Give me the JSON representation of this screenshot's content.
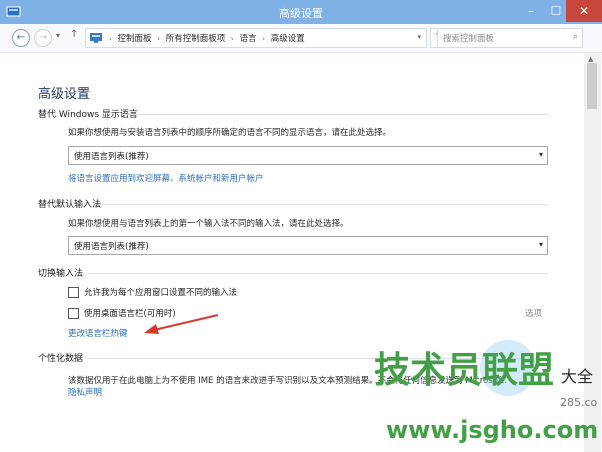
{
  "window": {
    "title": "高级设置"
  },
  "nav": {
    "up_label": "↑",
    "back_label": "←",
    "forward_label": "→",
    "recent_label": "▾"
  },
  "breadcrumb": {
    "items": [
      "控制面板",
      "所有控制面板项",
      "语言",
      "高级设置"
    ]
  },
  "search": {
    "placeholder": "搜索控制面板"
  },
  "page": {
    "title": "高级设置"
  },
  "display_language": {
    "heading": "替代 Windows 显示语言",
    "description": "如果你想使用与安装语言列表中的顺序所确定的语言不同的显示语言，请在此处选择。",
    "selected": "使用语言列表(推荐)",
    "link": "将语言设置应用到欢迎屏幕、系统帐户和新用户帐户"
  },
  "input_method": {
    "heading": "替代默认输入法",
    "description": "如果你想使用与语言列表上的第一个输入法不同的输入法，请在此处选择。",
    "selected": "使用语言列表(推荐)"
  },
  "switch_input": {
    "heading": "切换输入法",
    "option1": "允许我为每个应用窗口设置不同的输入法",
    "option2": "使用桌面语言栏(可用时)",
    "options_label": "选项",
    "link": "更改语言栏热键"
  },
  "personalization": {
    "heading": "个性化数据",
    "description": "该数据仅用于在此电脑上为不使用 IME 的语言来改进手写识别以及文本预测结果。不会将任何信息发送到 Microsoft.",
    "privacy_link": "隐私声明"
  },
  "watermark": {
    "text": "技术员联盟",
    "url": "www.jsgho.com",
    "side_text": "大全",
    "small_text": "285.com"
  },
  "colors": {
    "titlebar": "#7fb1e6",
    "link": "#2d6fb7",
    "heading": "#1e395b",
    "close": "#c8473d",
    "annotation_arrow": "#d93a2e",
    "watermark_green": "#43a047"
  }
}
